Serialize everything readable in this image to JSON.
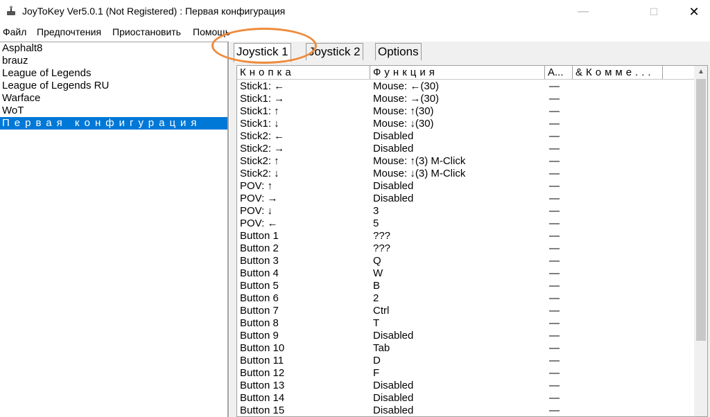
{
  "window": {
    "title": "JoyToKey Ver5.0.1 (Not Registered) : Первая конфигурация",
    "minimize": "—",
    "maximize": "☐",
    "close": "✕"
  },
  "menu": [
    "Файл",
    "Предпочтения",
    "Приостановить",
    "Помощь"
  ],
  "configs": [
    "Asphalt8",
    "brauz",
    "League of Legends",
    "League of Legends RU",
    "Warface",
    "WoT",
    "Первая конфигурация"
  ],
  "selected_config": "Первая конфигурация",
  "tabs": [
    "Joystick 1",
    "Joystick 2",
    "Options"
  ],
  "active_tab": "Joystick 1",
  "columns": [
    "Кнопка",
    "Функция",
    "A...",
    "&Комме..."
  ],
  "rows": [
    {
      "button": "Stick1: ←",
      "func": "Mouse: ←(30)",
      "a": "—"
    },
    {
      "button": "Stick1: →",
      "func": "Mouse: →(30)",
      "a": "—"
    },
    {
      "button": "Stick1: ↑",
      "func": "Mouse: ↑(30)",
      "a": "—"
    },
    {
      "button": "Stick1: ↓",
      "func": "Mouse: ↓(30)",
      "a": "—"
    },
    {
      "button": "Stick2: ←",
      "func": "Disabled",
      "a": "—"
    },
    {
      "button": "Stick2: →",
      "func": "Disabled",
      "a": "—"
    },
    {
      "button": "Stick2: ↑",
      "func": "Mouse: ↑(3) M-Click",
      "a": "—"
    },
    {
      "button": "Stick2: ↓",
      "func": "Mouse: ↓(3) M-Click",
      "a": "—"
    },
    {
      "button": "POV: ↑",
      "func": "Disabled",
      "a": "—"
    },
    {
      "button": "POV: →",
      "func": "Disabled",
      "a": "—"
    },
    {
      "button": "POV: ↓",
      "func": "3",
      "a": "—"
    },
    {
      "button": "POV: ←",
      "func": "5",
      "a": "—"
    },
    {
      "button": "Button 1",
      "func": "???",
      "a": "—"
    },
    {
      "button": "Button 2",
      "func": "???",
      "a": "—"
    },
    {
      "button": "Button 3",
      "func": "Q",
      "a": "—"
    },
    {
      "button": "Button 4",
      "func": "W",
      "a": "—"
    },
    {
      "button": "Button 5",
      "func": "B",
      "a": "—"
    },
    {
      "button": "Button 6",
      "func": "2",
      "a": "—"
    },
    {
      "button": "Button 7",
      "func": "Ctrl",
      "a": "—"
    },
    {
      "button": "Button 8",
      "func": "T",
      "a": "—"
    },
    {
      "button": "Button 9",
      "func": "Disabled",
      "a": "—"
    },
    {
      "button": "Button 10",
      "func": "Tab",
      "a": "—"
    },
    {
      "button": "Button 11",
      "func": "D",
      "a": "—"
    },
    {
      "button": "Button 12",
      "func": "F",
      "a": "—"
    },
    {
      "button": "Button 13",
      "func": "Disabled",
      "a": "—"
    },
    {
      "button": "Button 14",
      "func": "Disabled",
      "a": "—"
    },
    {
      "button": "Button 15",
      "func": "Disabled",
      "a": "—"
    }
  ],
  "colors": {
    "selection": "#0078d7",
    "annotation_ring": "#ef8a3a",
    "panel_bg": "#f0f0f0"
  }
}
